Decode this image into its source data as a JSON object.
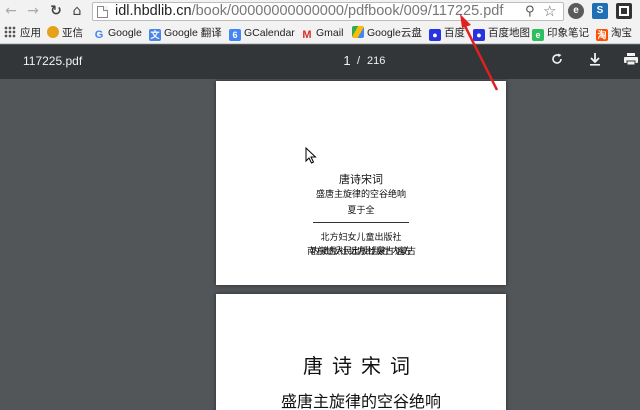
{
  "browser": {
    "url_host": "idl.hbdlib.cn",
    "url_path": "/book/00000000000000/pdfbook/009/117225.pdf"
  },
  "bookmarks": [
    {
      "label": "应用",
      "icon": "apps-icon"
    },
    {
      "label": "亚信",
      "icon": "yaxin-icon"
    },
    {
      "label": "Google",
      "icon": "google-icon"
    },
    {
      "label": "Google 翻译",
      "icon": "translate-icon"
    },
    {
      "label": "GCalendar",
      "icon": "calendar-icon"
    },
    {
      "label": "Gmail",
      "icon": "gmail-icon"
    },
    {
      "label": "Google云盘",
      "icon": "drive-icon"
    },
    {
      "label": "百度",
      "icon": "baidu-icon"
    },
    {
      "label": "百度地图",
      "icon": "baidu-map-icon"
    },
    {
      "label": "印象笔记",
      "icon": "evernote-icon"
    },
    {
      "label": "淘宝",
      "icon": "taobao-icon"
    }
  ],
  "pdf": {
    "filename": "117225.pdf",
    "current_page": "1",
    "page_separator": "/",
    "total_pages": "216"
  },
  "pages": {
    "p1": {
      "title": "唐诗宋词",
      "subtitle": "盛唐主旋律的空谷绝响",
      "author": "夏于全",
      "publisher": "北方妇女儿童出版社",
      "overlap_line_a": "南方出版社 远方出版社 内蒙古",
      "overlap_line_b": "内蒙古人民出版社 蒙古 远方"
    },
    "p2": {
      "title": "唐诗宋词",
      "subtitle": "盛唐主旋律的空谷绝响"
    }
  },
  "colors": {
    "pdf_toolbar": "#323639",
    "viewer_bg": "#525659",
    "annotation_arrow": "#e02020"
  }
}
